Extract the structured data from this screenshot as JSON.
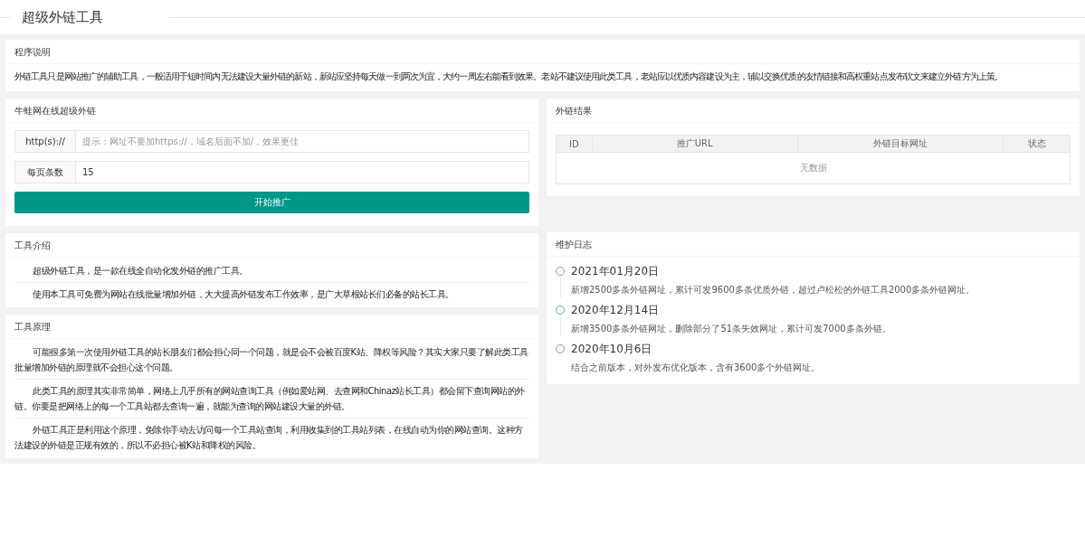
{
  "header": {
    "title": "超级外链工具"
  },
  "intro": {
    "title": "程序说明",
    "text": "外链工具只是网站推广的辅助工具，一般适用于短时间内无法建设大量外链的新站，新站应坚持每天做一到两次为宜，大约一周左右能看到效果。老站不建议使用此类工具，老站应以优质内容建设为主，辅以交换优质的友情链接和高权重站点发布软文来建立外链方为上策。"
  },
  "form": {
    "title": "牛蛙网在线超级外链",
    "fields": [
      {
        "label": "http(s)://",
        "placeholder": "提示：网址不要加https://，域名后面不加/，效果更佳"
      },
      {
        "label": "每页条数",
        "value": "15"
      }
    ],
    "button": "开始推广"
  },
  "results": {
    "title": "外链结果",
    "columns": [
      "ID",
      "推广URL",
      "外链目标网址",
      "状态"
    ],
    "empty": "无数据"
  },
  "about": {
    "title": "工具介绍",
    "paragraphs": [
      "超级外链工具，是一款在线全自动化发外链的推广工具。",
      "使用本工具可免费为网站在线批量增加外链，大大提高外链发布工作效率，是广大草根站长们必备的站长工具。"
    ]
  },
  "principle": {
    "title": "工具原理",
    "paragraphs": [
      "可能很多第一次使用外链工具的站长朋友们都会担心同一个问题，就是会不会被百度K站、降权等风险？其实大家只要了解此类工具批量增加外链的原理就不会担心这个问题。",
      "此类工具的原理其实非常简单，网络上几乎所有的网站查询工具（例如爱站网、去查网和Chinaz站长工具）都会留下查询网站的外链。你要是把网络上的每一个工具站都去查询一遍，就能为查询的网站建设大量的外链。",
      "外链工具正是利用这个原理，免除你手动去访问每一个工具站查询，利用收集到的工具站列表，在线自动为你的网站查询。这种方法建设的外链是正规有效的，所以不必担心被K站和降权的风险。"
    ]
  },
  "log": {
    "title": "维护日志",
    "entries": [
      {
        "date": "2021年01月20日",
        "text": "新增2500多条外链网址，累计可发9600多条优质外链，超过卢松松的外链工具2000多条外链网址。"
      },
      {
        "date": "2020年12月14日",
        "text": "新增3500多条外链网址，删除部分了51条失效网址，累计可发7000多条外链。"
      },
      {
        "date": "2020年10月6日",
        "text": "结合之前版本，对外发布优化版本，含有3600多个外链网址。"
      }
    ]
  }
}
